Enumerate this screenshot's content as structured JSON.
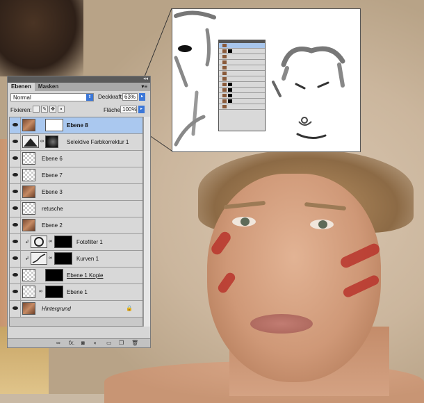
{
  "panel": {
    "tabs": [
      "Ebenen",
      "Masken"
    ],
    "blend_mode": "Normal",
    "opacity_label": "Deckkraft:",
    "opacity_value": "63%",
    "lock_label": "Fixieren:",
    "fill_label": "Fläche:",
    "fill_value": "100%",
    "layers": [
      {
        "name": "Ebene 8",
        "selected": true
      },
      {
        "name": "Selektive Farbkorrektur 1"
      },
      {
        "name": "Ebene 6"
      },
      {
        "name": "Ebene 7"
      },
      {
        "name": "Ebene 3"
      },
      {
        "name": "retusche"
      },
      {
        "name": "Ebene 2"
      },
      {
        "name": "Fotofilter 1"
      },
      {
        "name": "Kurven 1"
      },
      {
        "name": "Ebene 1 Kopie"
      },
      {
        "name": "Ebene 1"
      },
      {
        "name": "Hintergrund"
      }
    ],
    "bottom_icons": [
      "link-icon",
      "fx-icon",
      "mask-icon",
      "adjustment-icon",
      "folder-icon",
      "new-layer-icon",
      "trash-icon"
    ]
  }
}
